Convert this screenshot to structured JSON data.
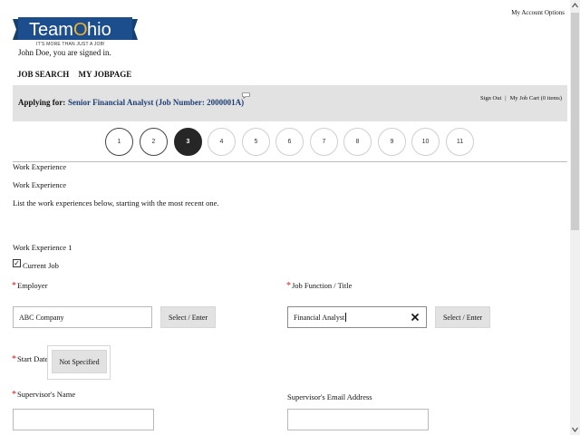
{
  "header": {
    "logo_team": "Team",
    "logo_o": "O",
    "logo_hio": "hio",
    "logo_tagline": "IT'S MORE THAN JUST A JOB!",
    "signed_in": "John Doe, you are signed in.",
    "account_options": "My Account Options"
  },
  "nav": {
    "items": [
      "JOB SEARCH",
      "MY JOBPAGE"
    ]
  },
  "banner": {
    "applying_label": "Applying for:",
    "job_title": "Senior Financial Analyst (Job Number: 2000001A)",
    "sign_out": "Sign Out",
    "separator": "|",
    "job_cart": "My Job Cart (0 items)"
  },
  "steps": {
    "labels": [
      "1",
      "2",
      "3",
      "4",
      "5",
      "6",
      "7",
      "8",
      "9",
      "10",
      "11"
    ],
    "current": 3
  },
  "form": {
    "section_title": "Work Experience",
    "subsection_title": "Work Experience",
    "instructions": "List the work experiences below, starting with the most recent one.",
    "entry_title": "Work Experience 1",
    "current_job_label": "Current Job",
    "current_job_checked": true,
    "required_marker": "*",
    "employer_label": "Employer",
    "employer_value": "ABC Company",
    "employer_button": "Select / Enter",
    "job_function_label": "Job Function / Title",
    "job_function_value": "Financial Analyst",
    "job_function_button": "Select / Enter",
    "start_date_label": "Start Date",
    "start_date_button": "Not Specified",
    "supervisor_name_label": "Supervisor's Name",
    "supervisor_name_value": "",
    "supervisor_email_label": "Supervisor's Email Address",
    "supervisor_email_value": ""
  },
  "colors": {
    "logo_blue": "#1c4d8c",
    "logo_o": "#f0b32a",
    "job_link": "#1f3f73",
    "required_star": "#d41f1f",
    "banner_bg": "#e2e2e2",
    "current_step": "#262626"
  }
}
